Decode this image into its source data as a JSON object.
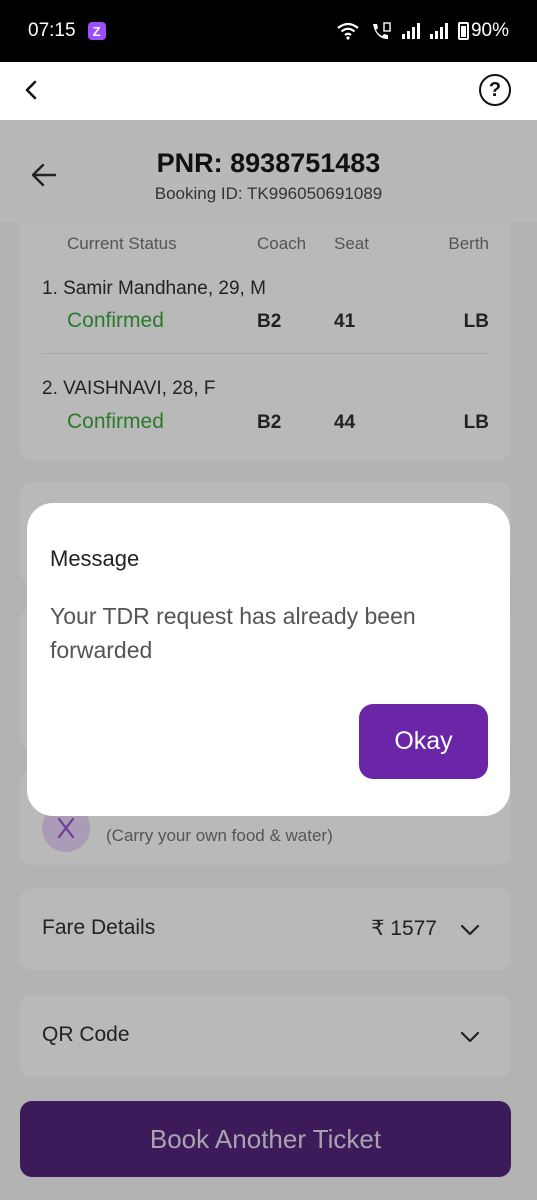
{
  "status_bar": {
    "time": "07:15",
    "app_badge": "Z",
    "battery": "90%"
  },
  "app_bar": {
    "help_glyph": "?"
  },
  "header": {
    "pnr": "PNR: 8938751483",
    "booking_id": "Booking ID: TK996050691089"
  },
  "passengers": {
    "columns": {
      "status": "Current Status",
      "coach": "Coach",
      "seat": "Seat",
      "berth": "Berth"
    },
    "rows": [
      {
        "name": "1. Samir Mandhane, 29, M",
        "status": "Confirmed",
        "coach": "B2",
        "seat": "41",
        "berth": "LB"
      },
      {
        "name": "2. VAISHNAVI, 28, F",
        "status": "Confirmed",
        "coach": "B2",
        "seat": "44",
        "berth": "LB"
      }
    ]
  },
  "food": {
    "note": "(Carry your own food & water)"
  },
  "fare": {
    "label": "Fare Details",
    "amount": "₹ 1577"
  },
  "qr": {
    "label": "QR Code"
  },
  "book_button": "Book Another Ticket",
  "modal": {
    "title": "Message",
    "message": "Your TDR request has already been forwarded",
    "ok_label": "Okay"
  },
  "colors": {
    "primary": "#6a26a6",
    "confirmed": "#2a7a2a"
  }
}
